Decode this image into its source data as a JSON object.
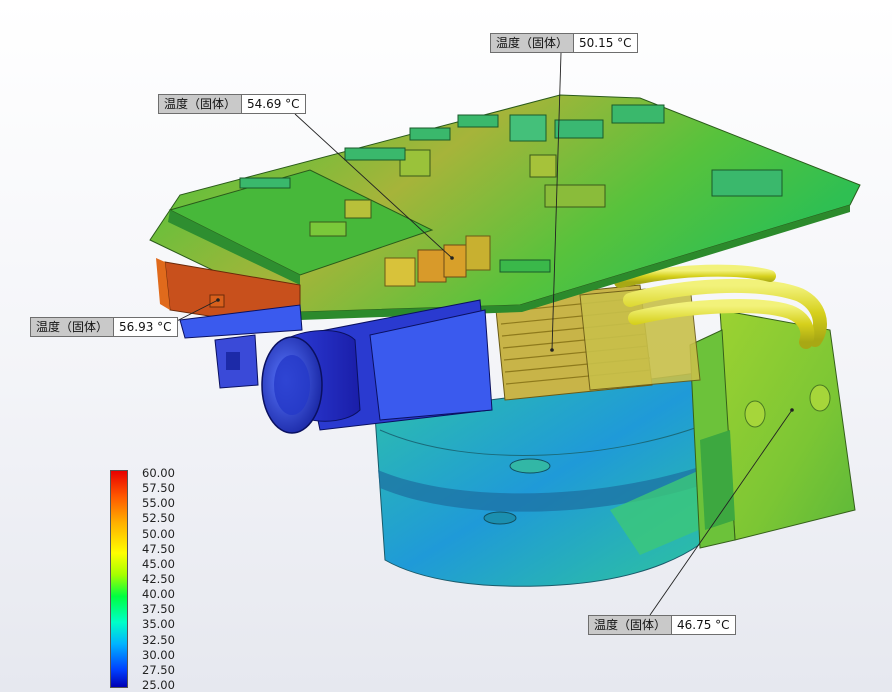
{
  "probes": [
    {
      "label": "温度（固体）",
      "value": "50.15 °C"
    },
    {
      "label": "温度（固体）",
      "value": "54.69 °C"
    },
    {
      "label": "温度（固体）",
      "value": "56.93 °C"
    },
    {
      "label": "温度（固体）",
      "value": "46.75 °C"
    }
  ],
  "legend": {
    "ticks": [
      "60.00",
      "57.50",
      "55.00",
      "52.50",
      "50.00",
      "47.50",
      "45.00",
      "42.50",
      "40.00",
      "37.50",
      "35.00",
      "32.50",
      "30.00",
      "27.50",
      "25.00"
    ]
  },
  "colors": {
    "hot": "#e80000",
    "warm": "#ffff00",
    "mid": "#00ff40",
    "cool": "#00b4ff",
    "cold": "#0000b4"
  }
}
